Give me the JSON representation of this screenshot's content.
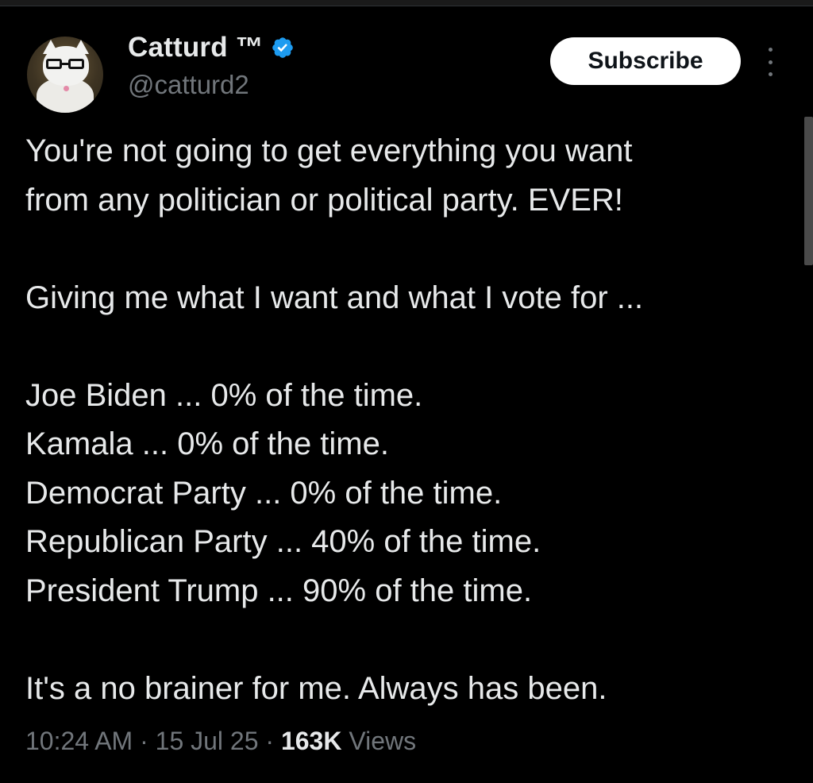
{
  "author": {
    "display_name": "Catturd ™",
    "handle": "@catturd2",
    "verified_color": "#1d9bf0",
    "avatar_icon": "cat-with-glasses-avatar"
  },
  "actions": {
    "subscribe_label": "Subscribe",
    "more_icon": "more-vertical-icon"
  },
  "tweet": {
    "lines": [
      "You're not going to get everything you want",
      "from any politician or political party. EVER!",
      "",
      "Giving me what I want and what I vote for ...",
      "",
      "Joe Biden ... 0% of the time.",
      "Kamala ... 0% of the time.",
      "Democrat Party ... 0% of the time.",
      "Republican Party ... 40% of the time.",
      "President Trump ... 90% of the time.",
      "",
      "It's a no brainer for me. Always has been."
    ]
  },
  "meta": {
    "time": "10:24 AM",
    "separator": "·",
    "date": "15 Jul 25",
    "views_count": "163K",
    "views_label": "Views"
  },
  "colors": {
    "background": "#000000",
    "text": "#e7e9ea",
    "muted": "#71767b",
    "verified": "#1d9bf0"
  }
}
